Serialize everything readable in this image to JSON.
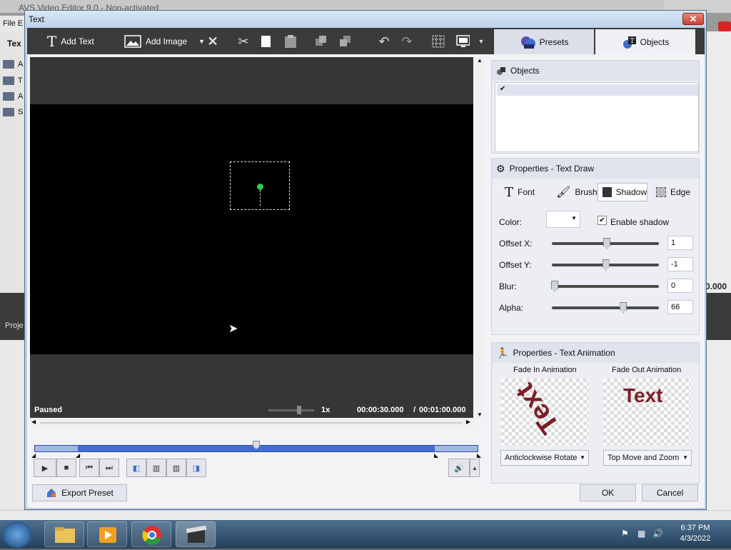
{
  "background_app": {
    "title": "AVS Video Editor 9.0 - Non-activated",
    "menu": "File  E",
    "left_tab": "Tex",
    "folders": [
      "A",
      "T",
      "A",
      "S"
    ],
    "project_label": "Proje",
    "timecode_fragment": "0.000"
  },
  "dialog": {
    "title": "Text",
    "close_glyph": "✕"
  },
  "toolbar": {
    "add_text": "Add Text",
    "add_image": "Add Image"
  },
  "tabs": {
    "presets": "Presets",
    "objects": "Objects"
  },
  "preview": {
    "status": "Paused",
    "speed": "1x",
    "time_current": "00:00:30.000",
    "time_separator": "/",
    "time_total": "00:01:00.000",
    "seek_position": 0.5
  },
  "objects_panel": {
    "title": "Objects",
    "items": [
      {
        "checked": true,
        "label": ""
      }
    ]
  },
  "properties_text_draw": {
    "title": "Properties - Text Draw",
    "tabs": [
      "Font",
      "Brush",
      "Shadow",
      "Edge"
    ],
    "active_tab": "Shadow",
    "color_label": "Color:",
    "color_value": "#ffffff",
    "enable_shadow_label": "Enable shadow",
    "enable_shadow": true,
    "params": [
      {
        "label": "Offset X:",
        "value": "1",
        "level": 0.5
      },
      {
        "label": "Offset Y:",
        "value": "-1",
        "level": 0.49
      },
      {
        "label": "Blur:",
        "value": "0",
        "level": 0.0
      },
      {
        "label": "Alpha:",
        "value": "66",
        "level": 0.66
      }
    ]
  },
  "properties_text_animation": {
    "title": "Properties - Text Animation",
    "fade_in_label": "Fade In Animation",
    "fade_out_label": "Fade Out Animation",
    "fade_in_preview_text": "Text",
    "fade_out_preview_text": "Text",
    "fade_in_value": "Anticlockwise Rotate",
    "fade_out_value": "Top Move and Zoom"
  },
  "footer": {
    "export_preset": "Export Preset",
    "ok": "OK",
    "cancel": "Cancel"
  },
  "taskbar": {
    "time": "6:37 PM",
    "date": "4/3/2022"
  },
  "colors": {
    "accent_blue": "#3f6fd6",
    "dialog_frame": "#bcd0e6",
    "toolbar_dark": "#3b3b3b",
    "anim_text": "#7a1f28"
  }
}
